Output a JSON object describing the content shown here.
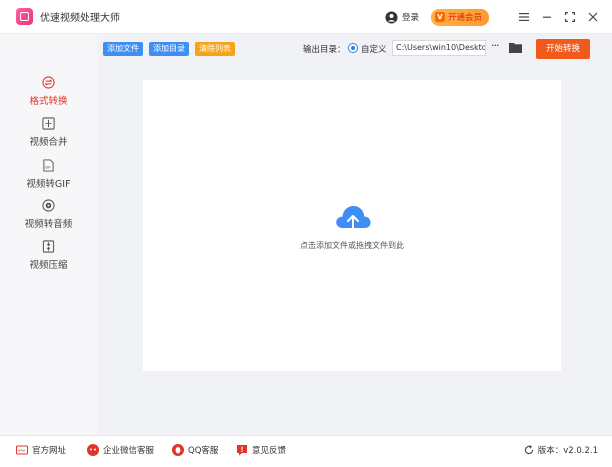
{
  "app": {
    "title": "优速视频处理大师"
  },
  "titlebar": {
    "login_label": "登录",
    "vip_label": "开通会员",
    "vip_icon_text": "V"
  },
  "sidebar": {
    "items": [
      {
        "label": "格式转换",
        "icon": "convert-icon",
        "active": true
      },
      {
        "label": "视频合并",
        "icon": "merge-icon",
        "active": false
      },
      {
        "label": "视频转GIF",
        "icon": "gif-icon",
        "active": false
      },
      {
        "label": "视频转音频",
        "icon": "audio-icon",
        "active": false
      },
      {
        "label": "视频压缩",
        "icon": "compress-icon",
        "active": false
      }
    ]
  },
  "toolbar": {
    "add_file_label": "添加文件",
    "add_dir_label": "添加目录",
    "clear_list_label": "清除列表",
    "output_dir_label": "输出目录：",
    "custom_label": "自定义",
    "output_path": "C:\\Users\\win10\\Deskto",
    "more_label": "···",
    "start_label": "开始转换"
  },
  "drop": {
    "hint": "点击添加文件或拖拽文件到此"
  },
  "footer": {
    "links": [
      {
        "label": "官方网址",
        "icon": "website-icon"
      },
      {
        "label": "企业微信客服",
        "icon": "wechat-service-icon"
      },
      {
        "label": "QQ客服",
        "icon": "qq-icon"
      },
      {
        "label": "意见反馈",
        "icon": "feedback-icon"
      }
    ],
    "version": "版本：v2.0.2.1"
  },
  "colors": {
    "accent_red": "#e0362a",
    "button_blue": "#3f8ef5",
    "button_orange": "#f6a31a",
    "start_orange": "#f05a1a",
    "cloud_blue": "#3f8ef5"
  }
}
